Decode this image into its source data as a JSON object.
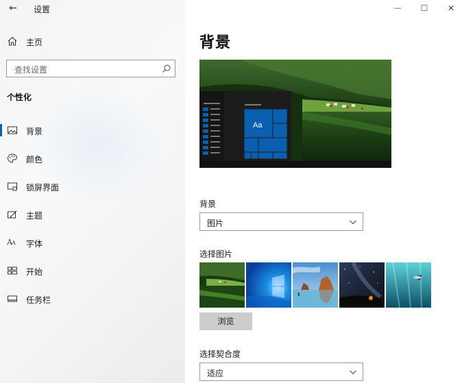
{
  "window": {
    "title": "设置",
    "back_icon": "arrow-left-icon",
    "controls": {
      "minimize": "—",
      "maximize": "☐",
      "close": "✕"
    }
  },
  "sidebar": {
    "home_label": "主页",
    "search_placeholder": "查找设置",
    "section_title": "个性化",
    "items": [
      {
        "label": "背景",
        "icon": "picture-icon",
        "active": true
      },
      {
        "label": "颜色",
        "icon": "palette-icon",
        "active": false
      },
      {
        "label": "锁屏界面",
        "icon": "lock-screen-icon",
        "active": false
      },
      {
        "label": "主题",
        "icon": "theme-brush-icon",
        "active": false
      },
      {
        "label": "字体",
        "icon": "font-icon",
        "active": false
      },
      {
        "label": "开始",
        "icon": "start-grid-icon",
        "active": false
      },
      {
        "label": "任务栏",
        "icon": "taskbar-icon",
        "active": false
      }
    ]
  },
  "main": {
    "title": "背景",
    "preview_tile_text": "Aa",
    "background_label": "背景",
    "background_value": "图片",
    "choose_picture_label": "选择图片",
    "browse_label": "浏览",
    "fit_label": "选择契合度",
    "fit_value": "适应",
    "thumbnails": [
      "lake-landscape",
      "windows-blue",
      "beach-rocks",
      "night-sky",
      "underwater"
    ]
  },
  "colors": {
    "accent": "#0063b1",
    "tile_blue": "#0a5fb0"
  }
}
